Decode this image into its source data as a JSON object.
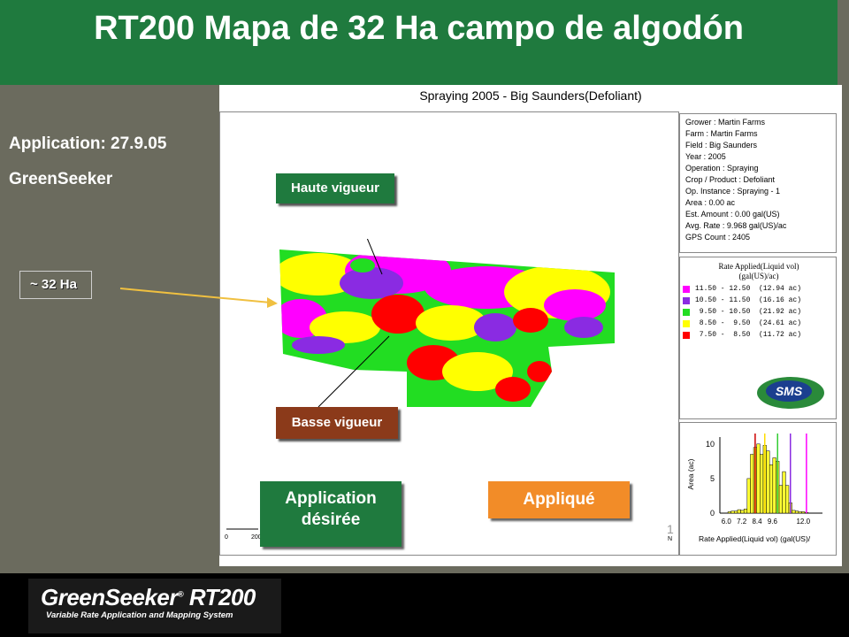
{
  "title": "RT200 Mapa de 32 Ha campo de algodón",
  "left": {
    "application_line": "Application: 27.9.05",
    "sensor_line": "GreenSeeker",
    "area_label": "~ 32 Ha"
  },
  "map": {
    "title": "Spraying 2005 - Big Saunders(Defoliant)",
    "info_lines": [
      "Grower : Martin Farms",
      "Farm : Martin Farms",
      "Field : Big Saunders",
      "Year : 2005",
      "Operation : Spraying",
      "Crop / Product : Defoliant",
      "Op. Instance : Spraying - 1",
      "Area : 0.00 ac",
      "Est. Amount : 0.00 gal(US)",
      "Avg. Rate : 9.968 gal(US)/ac",
      "GPS Count : 2405"
    ],
    "legend": {
      "title_line1": "Rate Applied(Liquid vol)",
      "title_line2": "(gal(US)/ac)",
      "rows": [
        {
          "text": "11.50 - 12.50  (12.94 ac)",
          "color": "#ff00ff"
        },
        {
          "text": "10.50 - 11.50  (16.16 ac)",
          "color": "#8a2be2"
        },
        {
          "text": " 9.50 - 10.50  (21.92 ac)",
          "color": "#22dd22"
        },
        {
          "text": " 8.50 -  9.50  (24.61 ac)",
          "color": "#ffff00"
        },
        {
          "text": " 7.50 -  8.50  (11.72 ac)",
          "color": "#ff0000"
        }
      ]
    },
    "scale_labels": [
      "0",
      "200"
    ],
    "north_label": "N",
    "page_number": "1",
    "logo": "SMS"
  },
  "annotations": {
    "high_vigor": "Haute vigueur",
    "low_vigor": "Basse vigueur",
    "desired_line1": "Application",
    "desired_line2": "désirée",
    "applied": "Appliqué"
  },
  "chart_data": {
    "type": "bar",
    "xlabel": "Rate Applied(Liquid vol) (gal(US)/",
    "ylabel": "Area (ac)",
    "x_ticks": [
      "6.0",
      "7.2",
      "8.4",
      "9.6",
      "12.0"
    ],
    "y_ticks": [
      "0",
      "5",
      "10"
    ],
    "ylim": [
      0,
      11
    ],
    "xlim": [
      5.5,
      13.5
    ],
    "bar_width": 0.25,
    "x": [
      6.0,
      6.25,
      6.5,
      6.75,
      7.0,
      7.25,
      7.5,
      7.75,
      8.0,
      8.25,
      8.5,
      8.75,
      9.0,
      9.25,
      9.5,
      9.75,
      10.0,
      10.25,
      10.5,
      10.75,
      11.0,
      11.25,
      11.5,
      11.75,
      12.0,
      12.25,
      12.5
    ],
    "values": [
      0,
      0.2,
      0.3,
      0.3,
      0.5,
      0.4,
      0.6,
      5,
      8.5,
      9.5,
      10,
      8.5,
      9.8,
      9,
      7,
      8,
      7.5,
      4,
      6,
      4,
      1.5,
      0.4,
      0.3,
      0.2,
      0.2,
      0.1,
      0
    ],
    "bar_color": "#ffff33",
    "markers": [
      {
        "x": 8.25,
        "color": "#cc0000"
      },
      {
        "x": 9.0,
        "color": "#ffdd00"
      },
      {
        "x": 10.0,
        "color": "#33cc33"
      },
      {
        "x": 11.0,
        "color": "#8a2be2"
      },
      {
        "x": 12.25,
        "color": "#ff00ff"
      }
    ]
  }
}
